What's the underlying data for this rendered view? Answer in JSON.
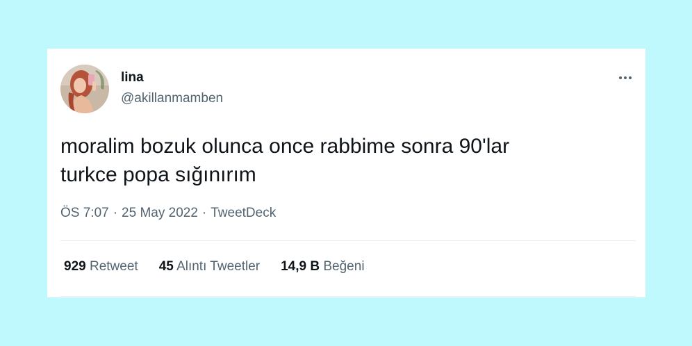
{
  "tweet": {
    "author": {
      "name": "lina",
      "handle": "@akillanmamben"
    },
    "text_line1": "moralim bozuk olunca once rabbime sonra 90'lar",
    "text_line2": "turkce popa sığınırım",
    "time": "ÖS 7:07",
    "date": "25 May 2022",
    "source": "TweetDeck",
    "separator": "·",
    "stats": {
      "retweets_count": "929",
      "retweets_label": "Retweet",
      "quotes_count": "45",
      "quotes_label": "Alıntı Tweetler",
      "likes_count": "14,9 B",
      "likes_label": "Beğeni"
    }
  },
  "icons": {
    "more": "more-horizontal-icon"
  },
  "colors": {
    "background": "#bff9fd",
    "card": "#ffffff",
    "text_primary": "#0f1419",
    "text_secondary": "#536471",
    "divider": "#e6ecf0"
  }
}
